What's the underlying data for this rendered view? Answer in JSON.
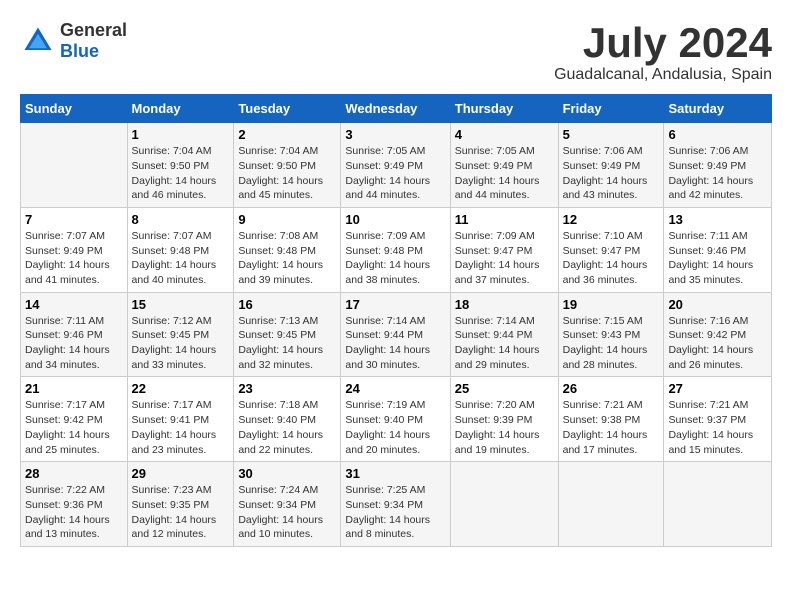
{
  "logo": {
    "general": "General",
    "blue": "Blue"
  },
  "header": {
    "month": "July 2024",
    "location": "Guadalcanal, Andalusia, Spain"
  },
  "days_of_week": [
    "Sunday",
    "Monday",
    "Tuesday",
    "Wednesday",
    "Thursday",
    "Friday",
    "Saturday"
  ],
  "weeks": [
    [
      {
        "day": "",
        "content": ""
      },
      {
        "day": "1",
        "content": "Sunrise: 7:04 AM\nSunset: 9:50 PM\nDaylight: 14 hours\nand 46 minutes."
      },
      {
        "day": "2",
        "content": "Sunrise: 7:04 AM\nSunset: 9:50 PM\nDaylight: 14 hours\nand 45 minutes."
      },
      {
        "day": "3",
        "content": "Sunrise: 7:05 AM\nSunset: 9:49 PM\nDaylight: 14 hours\nand 44 minutes."
      },
      {
        "day": "4",
        "content": "Sunrise: 7:05 AM\nSunset: 9:49 PM\nDaylight: 14 hours\nand 44 minutes."
      },
      {
        "day": "5",
        "content": "Sunrise: 7:06 AM\nSunset: 9:49 PM\nDaylight: 14 hours\nand 43 minutes."
      },
      {
        "day": "6",
        "content": "Sunrise: 7:06 AM\nSunset: 9:49 PM\nDaylight: 14 hours\nand 42 minutes."
      }
    ],
    [
      {
        "day": "7",
        "content": "Sunrise: 7:07 AM\nSunset: 9:49 PM\nDaylight: 14 hours\nand 41 minutes."
      },
      {
        "day": "8",
        "content": "Sunrise: 7:07 AM\nSunset: 9:48 PM\nDaylight: 14 hours\nand 40 minutes."
      },
      {
        "day": "9",
        "content": "Sunrise: 7:08 AM\nSunset: 9:48 PM\nDaylight: 14 hours\nand 39 minutes."
      },
      {
        "day": "10",
        "content": "Sunrise: 7:09 AM\nSunset: 9:48 PM\nDaylight: 14 hours\nand 38 minutes."
      },
      {
        "day": "11",
        "content": "Sunrise: 7:09 AM\nSunset: 9:47 PM\nDaylight: 14 hours\nand 37 minutes."
      },
      {
        "day": "12",
        "content": "Sunrise: 7:10 AM\nSunset: 9:47 PM\nDaylight: 14 hours\nand 36 minutes."
      },
      {
        "day": "13",
        "content": "Sunrise: 7:11 AM\nSunset: 9:46 PM\nDaylight: 14 hours\nand 35 minutes."
      }
    ],
    [
      {
        "day": "14",
        "content": "Sunrise: 7:11 AM\nSunset: 9:46 PM\nDaylight: 14 hours\nand 34 minutes."
      },
      {
        "day": "15",
        "content": "Sunrise: 7:12 AM\nSunset: 9:45 PM\nDaylight: 14 hours\nand 33 minutes."
      },
      {
        "day": "16",
        "content": "Sunrise: 7:13 AM\nSunset: 9:45 PM\nDaylight: 14 hours\nand 32 minutes."
      },
      {
        "day": "17",
        "content": "Sunrise: 7:14 AM\nSunset: 9:44 PM\nDaylight: 14 hours\nand 30 minutes."
      },
      {
        "day": "18",
        "content": "Sunrise: 7:14 AM\nSunset: 9:44 PM\nDaylight: 14 hours\nand 29 minutes."
      },
      {
        "day": "19",
        "content": "Sunrise: 7:15 AM\nSunset: 9:43 PM\nDaylight: 14 hours\nand 28 minutes."
      },
      {
        "day": "20",
        "content": "Sunrise: 7:16 AM\nSunset: 9:42 PM\nDaylight: 14 hours\nand 26 minutes."
      }
    ],
    [
      {
        "day": "21",
        "content": "Sunrise: 7:17 AM\nSunset: 9:42 PM\nDaylight: 14 hours\nand 25 minutes."
      },
      {
        "day": "22",
        "content": "Sunrise: 7:17 AM\nSunset: 9:41 PM\nDaylight: 14 hours\nand 23 minutes."
      },
      {
        "day": "23",
        "content": "Sunrise: 7:18 AM\nSunset: 9:40 PM\nDaylight: 14 hours\nand 22 minutes."
      },
      {
        "day": "24",
        "content": "Sunrise: 7:19 AM\nSunset: 9:40 PM\nDaylight: 14 hours\nand 20 minutes."
      },
      {
        "day": "25",
        "content": "Sunrise: 7:20 AM\nSunset: 9:39 PM\nDaylight: 14 hours\nand 19 minutes."
      },
      {
        "day": "26",
        "content": "Sunrise: 7:21 AM\nSunset: 9:38 PM\nDaylight: 14 hours\nand 17 minutes."
      },
      {
        "day": "27",
        "content": "Sunrise: 7:21 AM\nSunset: 9:37 PM\nDaylight: 14 hours\nand 15 minutes."
      }
    ],
    [
      {
        "day": "28",
        "content": "Sunrise: 7:22 AM\nSunset: 9:36 PM\nDaylight: 14 hours\nand 13 minutes."
      },
      {
        "day": "29",
        "content": "Sunrise: 7:23 AM\nSunset: 9:35 PM\nDaylight: 14 hours\nand 12 minutes."
      },
      {
        "day": "30",
        "content": "Sunrise: 7:24 AM\nSunset: 9:34 PM\nDaylight: 14 hours\nand 10 minutes."
      },
      {
        "day": "31",
        "content": "Sunrise: 7:25 AM\nSunset: 9:34 PM\nDaylight: 14 hours\nand 8 minutes."
      },
      {
        "day": "",
        "content": ""
      },
      {
        "day": "",
        "content": ""
      },
      {
        "day": "",
        "content": ""
      }
    ]
  ]
}
